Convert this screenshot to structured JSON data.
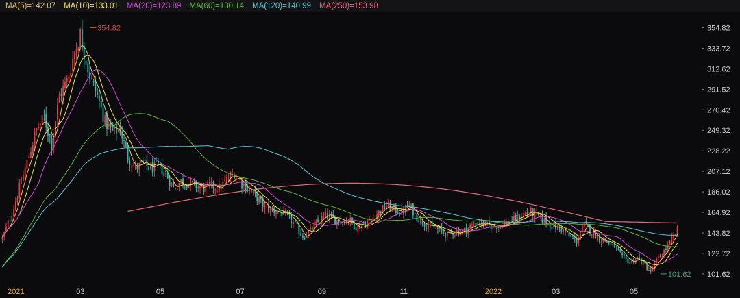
{
  "legend": [
    {
      "label": "MA(5)=142.07",
      "color": "#e8c45a"
    },
    {
      "label": "MA(10)=133.01",
      "color": "#f2e24a"
    },
    {
      "label": "MA(20)=123.89",
      "color": "#d14ad8"
    },
    {
      "label": "MA(60)=130.14",
      "color": "#5bb83a"
    },
    {
      "label": "MA(120)=140.99",
      "color": "#58c8d4"
    },
    {
      "label": "MA(250)=153.98",
      "color": "#e06a7a"
    }
  ],
  "chart_data": {
    "type": "line",
    "title": "",
    "xlabel": "",
    "ylabel": "",
    "ylim": [
      94.5,
      365
    ],
    "x_ticks": [
      {
        "label": "2021",
        "x": 0,
        "year": true
      },
      {
        "label": "03",
        "x": 40
      },
      {
        "label": "05",
        "x": 82
      },
      {
        "label": "07",
        "x": 124
      },
      {
        "label": "09",
        "x": 167
      },
      {
        "label": "11",
        "x": 210
      },
      {
        "label": "2022",
        "x": 251,
        "year": true
      },
      {
        "label": "03",
        "x": 290
      },
      {
        "label": "05",
        "x": 331
      }
    ],
    "y_ticks": [
      101.62,
      122.72,
      143.82,
      164.92,
      186.02,
      207.12,
      228.22,
      249.32,
      270.42,
      291.52,
      312.62,
      333.72,
      354.82
    ],
    "annotations": [
      {
        "label": "354.82",
        "x": 45,
        "y": 354.82,
        "side": "right",
        "color": "#e04040"
      },
      {
        "label": "101.62",
        "x": 345,
        "y": 101.62,
        "side": "right",
        "color": "#3aa07a"
      }
    ],
    "grid": false,
    "candles": {
      "up_color": "#e53d3d",
      "down_color": "#2fb8b0",
      "n": 356,
      "anchors": [
        [
          0,
          138
        ],
        [
          6,
          170
        ],
        [
          12,
          210
        ],
        [
          18,
          250
        ],
        [
          22,
          262
        ],
        [
          26,
          235
        ],
        [
          30,
          285
        ],
        [
          34,
          300
        ],
        [
          38,
          330
        ],
        [
          41,
          348
        ],
        [
          43,
          330
        ],
        [
          46,
          305
        ],
        [
          50,
          285
        ],
        [
          54,
          258
        ],
        [
          58,
          248
        ],
        [
          62,
          250
        ],
        [
          66,
          222
        ],
        [
          70,
          210
        ],
        [
          74,
          215
        ],
        [
          78,
          210
        ],
        [
          82,
          212
        ],
        [
          86,
          205
        ],
        [
          90,
          190
        ],
        [
          94,
          197
        ],
        [
          98,
          195
        ],
        [
          102,
          192
        ],
        [
          106,
          190
        ],
        [
          110,
          192
        ],
        [
          114,
          190
        ],
        [
          118,
          198
        ],
        [
          122,
          205
        ],
        [
          126,
          195
        ],
        [
          130,
          188
        ],
        [
          134,
          180
        ],
        [
          138,
          170
        ],
        [
          142,
          167
        ],
        [
          146,
          165
        ],
        [
          150,
          160
        ],
        [
          154,
          152
        ],
        [
          158,
          140
        ],
        [
          162,
          146
        ],
        [
          166,
          155
        ],
        [
          170,
          162
        ],
        [
          174,
          158
        ],
        [
          178,
          155
        ],
        [
          182,
          158
        ],
        [
          186,
          150
        ],
        [
          190,
          152
        ],
        [
          194,
          158
        ],
        [
          198,
          165
        ],
        [
          202,
          172
        ],
        [
          206,
          168
        ],
        [
          210,
          165
        ],
        [
          214,
          172
        ],
        [
          218,
          160
        ],
        [
          222,
          154
        ],
        [
          226,
          150
        ],
        [
          230,
          146
        ],
        [
          234,
          142
        ],
        [
          238,
          146
        ],
        [
          242,
          145
        ],
        [
          246,
          150
        ],
        [
          250,
          155
        ],
        [
          254,
          152
        ],
        [
          258,
          150
        ],
        [
          262,
          152
        ],
        [
          266,
          155
        ],
        [
          270,
          158
        ],
        [
          274,
          163
        ],
        [
          278,
          165
        ],
        [
          282,
          160
        ],
        [
          286,
          155
        ],
        [
          290,
          150
        ],
        [
          294,
          148
        ],
        [
          298,
          140
        ],
        [
          302,
          135
        ],
        [
          306,
          152
        ],
        [
          310,
          145
        ],
        [
          314,
          138
        ],
        [
          318,
          135
        ],
        [
          322,
          130
        ],
        [
          326,
          118
        ],
        [
          330,
          114
        ],
        [
          334,
          118
        ],
        [
          338,
          110
        ],
        [
          341,
          104
        ],
        [
          344,
          115
        ],
        [
          347,
          122
        ],
        [
          350,
          130
        ],
        [
          353,
          140
        ],
        [
          355,
          147
        ]
      ],
      "extremes": [
        {
          "index": 41,
          "high": 354.82
        },
        {
          "index": 341,
          "low": 101.62
        }
      ]
    },
    "series": [
      {
        "name": "MA(5)",
        "period": 5,
        "color": "#e8c45a",
        "last": 142.07
      },
      {
        "name": "MA(10)",
        "period": 10,
        "color": "#f2e24a",
        "last": 133.01
      },
      {
        "name": "MA(20)",
        "period": 20,
        "color": "#d14ad8",
        "last": 123.89
      },
      {
        "name": "MA(60)",
        "period": 60,
        "color": "#5bb83a",
        "last": 130.14
      },
      {
        "name": "MA(120)",
        "period": 120,
        "color": "#58c8d4",
        "last": 140.99
      },
      {
        "name": "MA(250)",
        "period": 250,
        "color": "#e06a7a",
        "last": 153.98,
        "start_index": 66
      }
    ]
  }
}
